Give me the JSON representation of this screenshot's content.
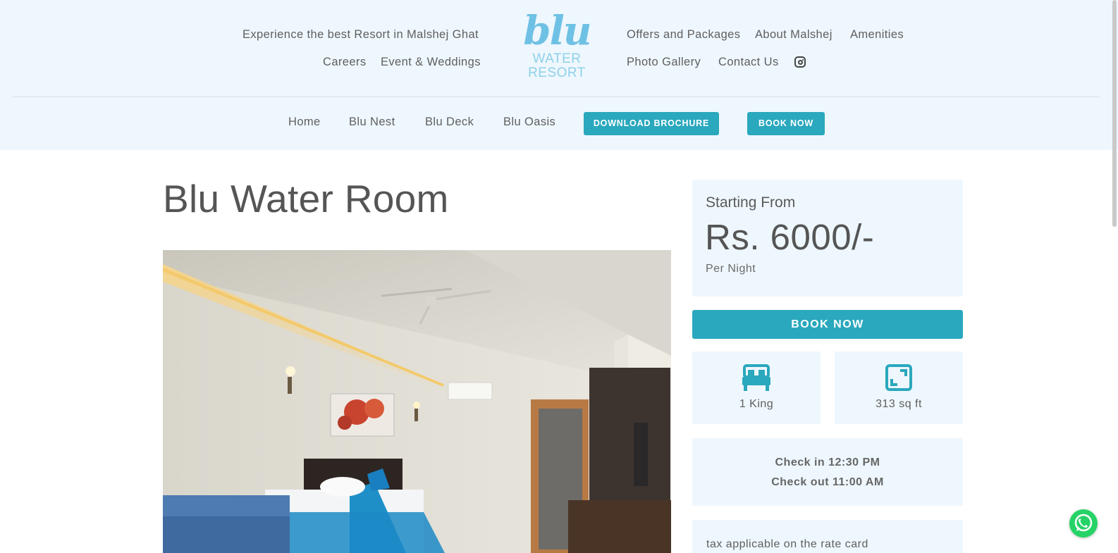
{
  "header": {
    "tagline": "Experience the best Resort in Malshej Ghat",
    "left_links": [
      "Careers",
      "Event & Weddings"
    ],
    "right_links_row1": [
      "Offers and Packages",
      "About Malshej",
      "Amenities"
    ],
    "right_links_row2": [
      "Photo Gallery",
      "Contact Us"
    ],
    "logo": {
      "script": "blu",
      "line1": "WATER",
      "line2": "RESORT"
    },
    "social_icon": "instagram-icon"
  },
  "subnav": {
    "links": [
      "Home",
      "Blu Nest",
      "Blu Deck",
      "Blu Oasis"
    ],
    "download_label": "DOWNLOAD BROCHURE",
    "book_label": "BOOK NOW"
  },
  "room": {
    "title": "Blu Water Room"
  },
  "pricing": {
    "label": "Starting From",
    "value": "Rs. 6000/-",
    "unit": "Per Night",
    "book_label": "BOOK NOW"
  },
  "features": [
    {
      "icon": "bed-icon",
      "label": "1 King"
    },
    {
      "icon": "expand-icon",
      "label": "313 sq ft"
    }
  ],
  "checks": {
    "check_in": "Check in 12:30 PM",
    "check_out": "Check out 11:00 AM"
  },
  "tax_note": "tax applicable on the rate card",
  "colors": {
    "accent": "#2aa8bd",
    "header_bg": "#eef7fd",
    "logo": "#6ec1e4",
    "whatsapp": "#25d366"
  }
}
